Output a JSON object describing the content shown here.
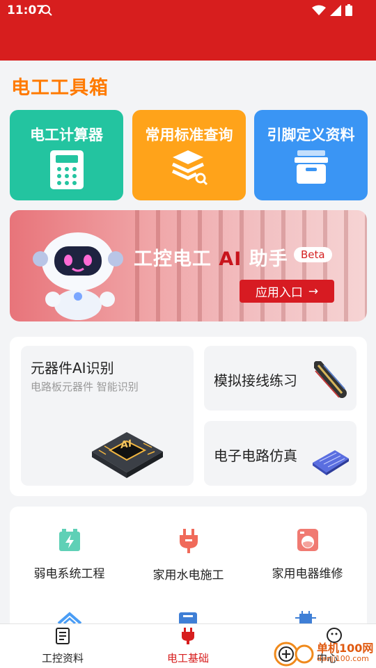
{
  "status_bar": {
    "time": "11:07"
  },
  "page_title": "电工工具箱",
  "tiles": [
    {
      "label": "电工计算器",
      "icon": "calculator-icon"
    },
    {
      "label": "常用标准查询",
      "icon": "layers-search-icon"
    },
    {
      "label": "引脚定义资料",
      "icon": "box-icon"
    }
  ],
  "banner": {
    "title_pre": "工控电工 ",
    "title_ai": "AI",
    "title_post": " 助手",
    "badge": "Beta",
    "button": "应用入口",
    "button_arrow": "→"
  },
  "ai_card": {
    "title": "元器件AI识别",
    "subtitle": "电路板元器件 智能识别",
    "chip_text": "AI"
  },
  "small_cards": [
    {
      "label": "模拟接线练习"
    },
    {
      "label": "电子电路仿真"
    }
  ],
  "grid": [
    {
      "label": "弱电系统工程",
      "icon": "battery-bolt-icon"
    },
    {
      "label": "家用水电施工",
      "icon": "plug-icon"
    },
    {
      "label": "家用电器维修",
      "icon": "washing-machine-icon"
    }
  ],
  "bottom_nav": [
    {
      "label": "工控资料",
      "icon": "book-icon"
    },
    {
      "label": "电工基础",
      "icon": "plug-icon",
      "active": true
    },
    {
      "label": "中心",
      "icon": "user-icon"
    }
  ],
  "watermark": {
    "name": "单机100网",
    "url": "danji100.com"
  },
  "colors": {
    "header_red": "#d71e1e",
    "title_orange": "#ff7a00",
    "tile_green": "#23c4a0",
    "tile_orange": "#ffa31a",
    "tile_blue": "#3a95f4"
  }
}
